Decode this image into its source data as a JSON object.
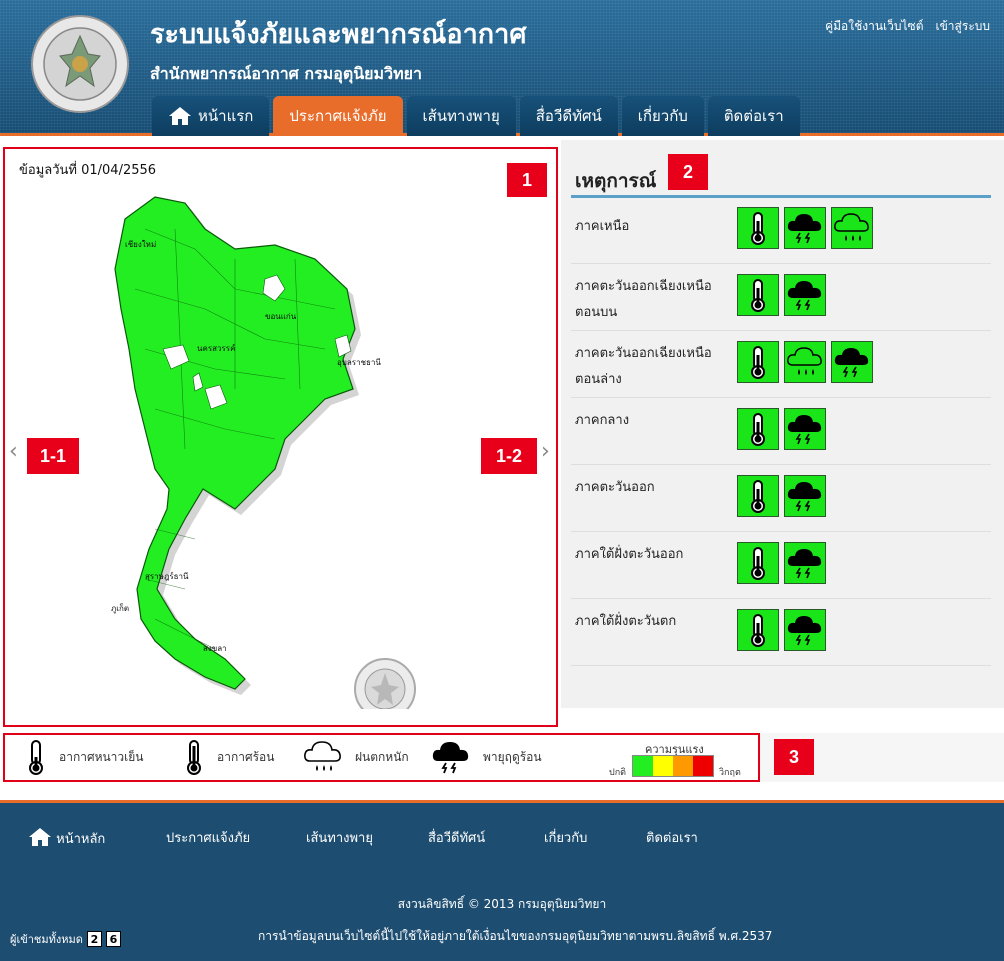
{
  "header": {
    "title": "ระบบแจ้งภัยและพยากรณ์อากาศ",
    "subtitle": "สำนักพยากรณ์อากาศ กรมอุตุนิยมวิทยา",
    "links": [
      "คู่มือใช้งานเว็บไซต์",
      "เข้าสู่ระบบ"
    ],
    "logo_icon": "meteorological-department-seal"
  },
  "nav": {
    "tabs": [
      {
        "label": "หน้าแรก",
        "icon": "home-icon"
      },
      {
        "label": "ประกาศแจ้งภัย",
        "active": true
      },
      {
        "label": "เส้นทางพายุ"
      },
      {
        "label": "สื่อวีดีทัศน์"
      },
      {
        "label": "เกี่ยวกับ"
      },
      {
        "label": "ติดต่อเรา"
      }
    ]
  },
  "map": {
    "date_text": "ข้อมูลวันที่ 01/04/2556",
    "fill_color": "#22ee22",
    "province_labels": [
      "เชียงใหม่",
      "ขอนแก่น",
      "นครสวรรค์",
      "อุบลราชธานี",
      "สุราษฎร์ธานี",
      "ภูเก็ต",
      "สงขลา"
    ],
    "prev_arrow": "‹",
    "next_arrow": "›"
  },
  "badges": {
    "map": "1",
    "events": "2",
    "legend": "3",
    "prev": "1-1",
    "next": "1-2"
  },
  "events": {
    "title": "เหตุการณ์",
    "regions": [
      {
        "name": "ภาคเหนือ",
        "icons": [
          "thermometer-icon",
          "thunderstorm-icon",
          "heavy-rain-icon"
        ]
      },
      {
        "name": "ภาคตะวันออกเฉียงเหนือตอนบน",
        "icons": [
          "thermometer-icon",
          "thunderstorm-icon"
        ]
      },
      {
        "name": "ภาคตะวันออกเฉียงเหนือตอนล่าง",
        "icons": [
          "thermometer-icon",
          "heavy-rain-icon",
          "thunderstorm-icon"
        ]
      },
      {
        "name": "ภาคกลาง",
        "icons": [
          "thermometer-icon",
          "thunderstorm-icon"
        ]
      },
      {
        "name": "ภาคตะวันออก",
        "icons": [
          "thermometer-icon",
          "thunderstorm-icon"
        ]
      },
      {
        "name": "ภาคใต้ฝั่งตะวันออก",
        "icons": [
          "thermometer-icon",
          "thunderstorm-icon"
        ]
      },
      {
        "name": "ภาคใต้ฝั่งตะวันตก",
        "icons": [
          "thermometer-icon",
          "thunderstorm-icon"
        ]
      }
    ]
  },
  "legend": {
    "items": [
      {
        "label": "อากาศหนาวเย็น",
        "icon": "cold-thermometer-icon"
      },
      {
        "label": "อากาศร้อน",
        "icon": "hot-thermometer-icon"
      },
      {
        "label": "ฝนตกหนัก",
        "icon": "heavy-rain-icon"
      },
      {
        "label": "พายุฤดูร้อน",
        "icon": "thunderstorm-icon"
      }
    ],
    "severity_title": "ความรุนแรง",
    "severity_low": "ปกติ",
    "severity_high": "วิกฤต",
    "severity_colors": [
      "#22ee22",
      "#ffff00",
      "#ff9900",
      "#ee0000"
    ]
  },
  "footer": {
    "nav": [
      "หน้าหลัก",
      "ประกาศแจ้งภัย",
      "เส้นทางพายุ",
      "สื่อวีดีทัศน์",
      "เกี่ยวกับ",
      "ติดต่อเรา"
    ],
    "copyright": "สงวนลิขสิทธิ์ © 2013 กรมอุตุนิยมวิทยา",
    "disclaimer": "การนำข้อมูลบนเว็บไซต์นี้ไปใช้ให้อยู่ภายใต้เงื่อนไขของกรมอุตุนิยมวิทยาตามพรบ.ลิขสิทธิ์ พ.ศ.2537",
    "visitor_label": "ผู้เข้าชมทั้งหมด",
    "visitor_digits": [
      "2",
      "6"
    ]
  }
}
